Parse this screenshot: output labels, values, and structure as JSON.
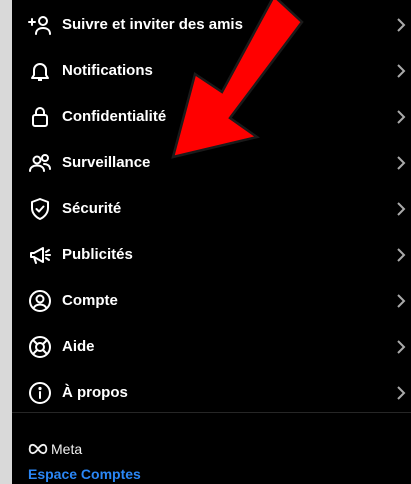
{
  "menu": {
    "items": [
      {
        "label": "Suivre et inviter des amis",
        "icon": "add-person-icon"
      },
      {
        "label": "Notifications",
        "icon": "bell-icon"
      },
      {
        "label": "Confidentialité",
        "icon": "lock-icon"
      },
      {
        "label": "Surveillance",
        "icon": "people-icon"
      },
      {
        "label": "Sécurité",
        "icon": "shield-icon"
      },
      {
        "label": "Publicités",
        "icon": "megaphone-icon"
      },
      {
        "label": "Compte",
        "icon": "account-circle-icon"
      },
      {
        "label": "Aide",
        "icon": "lifebuoy-icon"
      },
      {
        "label": "À propos",
        "icon": "info-icon"
      }
    ]
  },
  "footer": {
    "brand": "Meta",
    "link": "Espace Comptes"
  },
  "colors": {
    "background": "#000000",
    "text": "#ffffff",
    "link": "#2a86f5",
    "annotation_arrow": "#ff0000"
  }
}
